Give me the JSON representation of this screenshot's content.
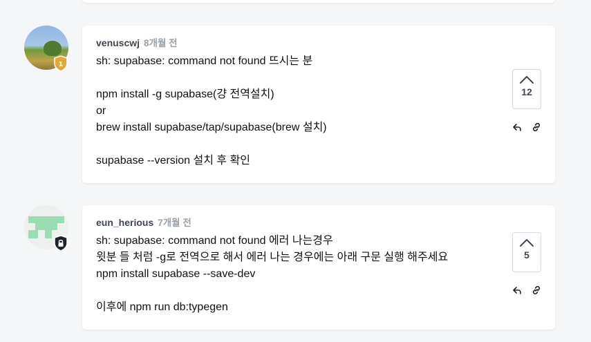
{
  "comments": [
    {
      "author": "venuscwj",
      "time": "8개월 전",
      "lines": [
        "sh: supabase: command not found 뜨시는 분",
        "",
        "npm install -g supabase(걍 전역설치)",
        "or",
        "brew install supabase/tap/supabase(brew 설치)",
        "",
        "supabase --version 설치 후 확인"
      ],
      "votes": "12",
      "badge_text": "1"
    },
    {
      "author": "eun_herious",
      "time": "7개월 전",
      "lines": [
        "sh: supabase: command not found 에러 나는경우",
        "윗분 들 처럼 -g로 전역으로 해서 에러 나는 경우에는 아래 구문 실행 해주세요",
        "npm install supabase --save-dev",
        "",
        "이후에 npm run db:typegen"
      ],
      "votes": "5"
    }
  ],
  "icons": {
    "upvote": "chevron-up-icon",
    "reply": "reply-icon",
    "link": "link-icon",
    "badge_gold": "shield-badge-icon",
    "badge_dark": "shield-lock-icon"
  },
  "colors": {
    "background": "#f5f6f8",
    "card": "#ffffff",
    "muted": "#9aa0a8",
    "gold": "#e0a83a"
  }
}
